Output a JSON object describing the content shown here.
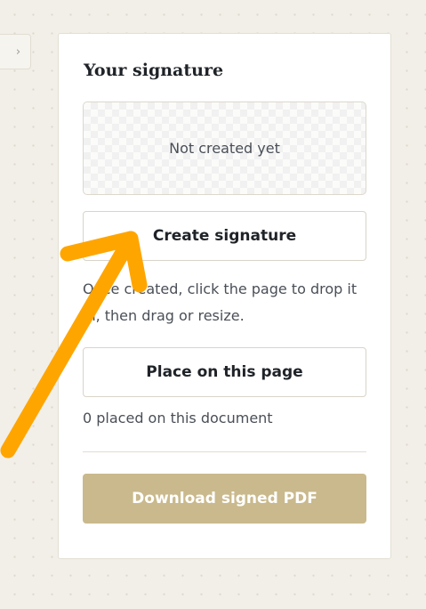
{
  "sidebar_toggle": {
    "icon": "chevron-right-icon",
    "glyph": "›"
  },
  "panel": {
    "title": "Your signature",
    "preview_placeholder": "Not created yet",
    "create_button": "Create signature",
    "hint": "Once created, click the page to drop it in, then drag or resize.",
    "place_button": "Place on this page",
    "placed_count_text": "0 placed on this document",
    "download_button": "Download signed PDF"
  },
  "annotation": {
    "icon": "arrow-annotation-icon",
    "color": "#ffa500"
  },
  "colors": {
    "background": "#f2efe8",
    "panel": "#ffffff",
    "accent_disabled": "#c9b98c",
    "text": "#1f2328"
  }
}
